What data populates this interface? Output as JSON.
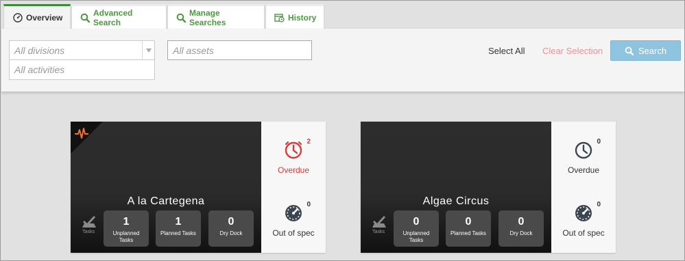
{
  "tabs": [
    {
      "label": "Overview",
      "icon": "gauge-icon",
      "active": true
    },
    {
      "label": "Advanced Search",
      "icon": "search-icon",
      "active": false
    },
    {
      "label": "Manage Searches",
      "icon": "search-icon",
      "active": false
    },
    {
      "label": "History",
      "icon": "calendar-clock-icon",
      "active": false
    }
  ],
  "filters": {
    "divisions_placeholder": "All divisions",
    "activities_placeholder": "All activities",
    "assets_placeholder": "All assets",
    "select_all": "Select All",
    "clear_selection": "Clear Selection",
    "search_label": "Search"
  },
  "colors": {
    "tab_green": "#4a9b3c",
    "search_button": "#8ec4e0",
    "clear_selection": "#e8939a",
    "overdue_alert": "#d83a3a",
    "pulse_orange": "#f0722a"
  },
  "cards": [
    {
      "name": "A la Cartegena",
      "tasks_label": "Tasks",
      "unplanned": {
        "value": "1",
        "label_line1": "Unplanned",
        "label_line2": "Tasks"
      },
      "planned": {
        "value": "1",
        "label": "Planned Tasks"
      },
      "drydock": {
        "value": "0",
        "label": "Dry Dock"
      },
      "overdue": {
        "count": "2",
        "label": "Overdue"
      },
      "out_of_spec": {
        "count": "0",
        "label": "Out of spec"
      }
    },
    {
      "name": "Algae Circus",
      "tasks_label": "Tasks",
      "unplanned": {
        "value": "0",
        "label_line1": "Unplanned",
        "label_line2": "Tasks"
      },
      "planned": {
        "value": "0",
        "label": "Planned Tasks"
      },
      "drydock": {
        "value": "0",
        "label": "Dry Dock"
      },
      "overdue": {
        "count": "0",
        "label": "Overdue"
      },
      "out_of_spec": {
        "count": "0",
        "label": "Out of spec"
      }
    }
  ]
}
